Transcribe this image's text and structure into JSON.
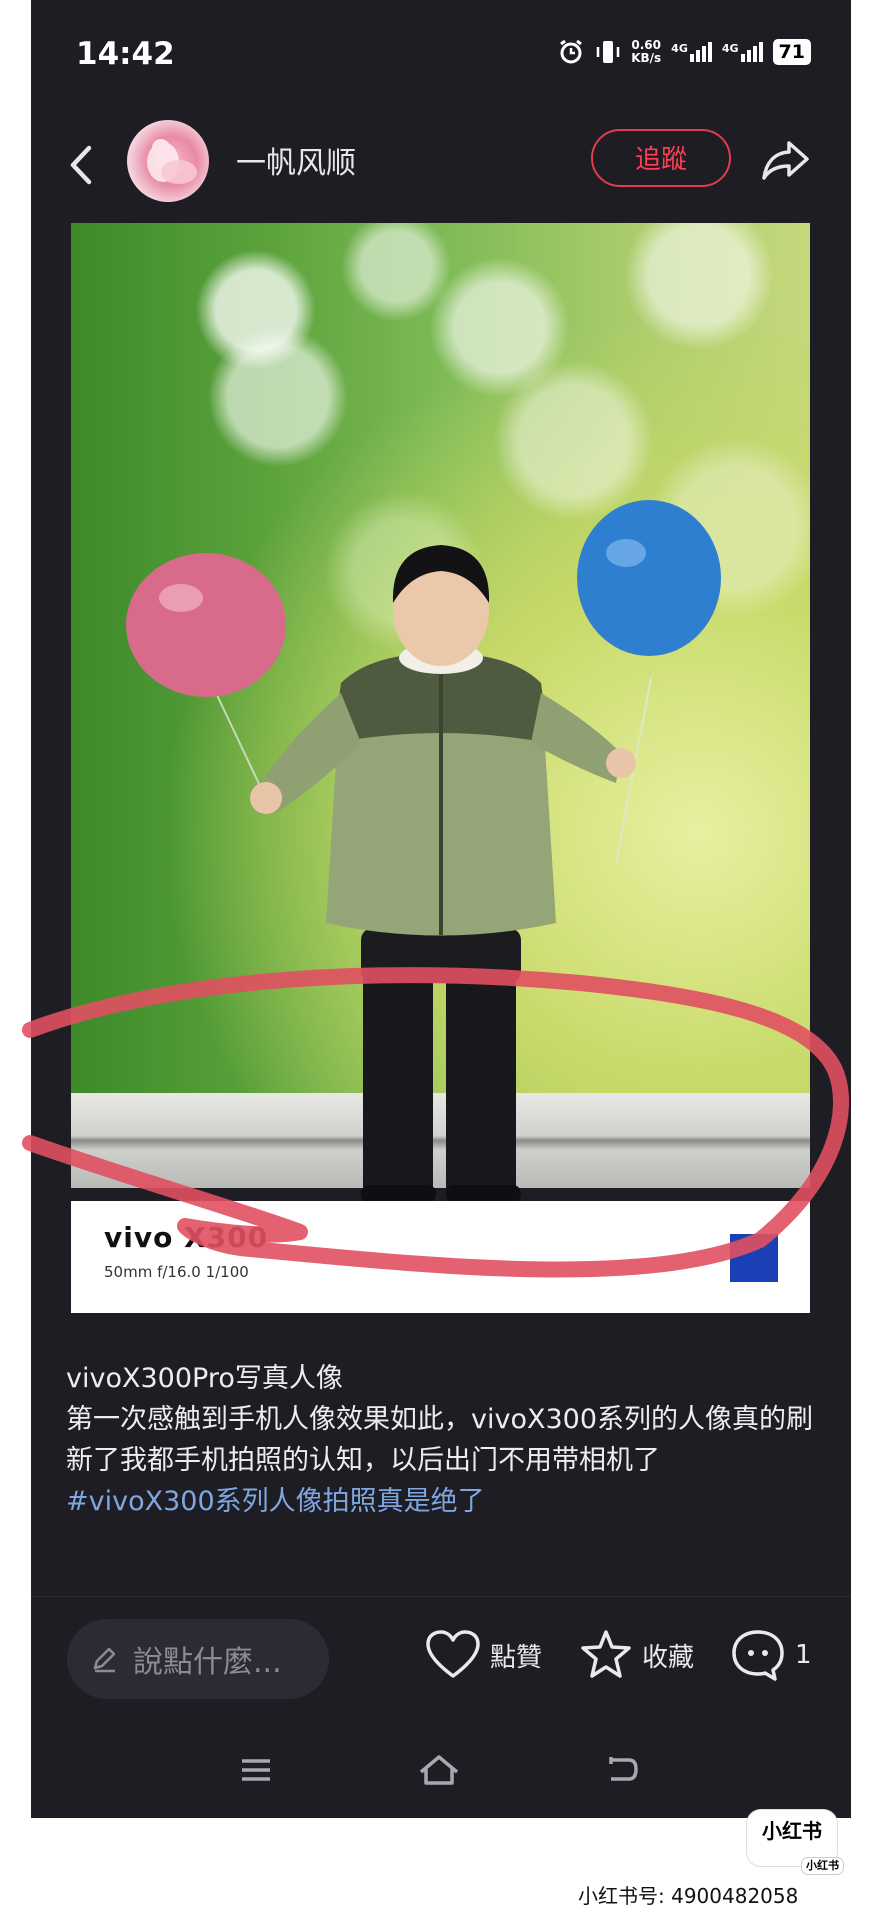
{
  "status_bar": {
    "time": "14:42",
    "net_speed_value": "0.60",
    "net_speed_unit": "KB/s",
    "network_1": "4G",
    "network_2": "4G",
    "battery": "71"
  },
  "header": {
    "username": "一帆风顺",
    "follow_label": "追蹤",
    "icons": [
      "back-arrow",
      "avatar",
      "share-arrow"
    ]
  },
  "photo": {
    "watermark_brand": "vivo X300",
    "watermark_spec": "50mm  f/16.0  1/100",
    "colors": {
      "bokeh": "#7dba55",
      "balloon_pink": "#d96b8a",
      "balloon_blue": "#2f7fd0",
      "scribble": "#e05060"
    }
  },
  "caption": {
    "title": "vivoX300Pro写真人像",
    "body": "第一次感触到手机人像效果如此，vivoX300系列的人像真的刷新了我都手机拍照的认知，以后出门不用带相机了",
    "hashtag": "#vivoX300系列人像拍照真是绝了"
  },
  "actions": {
    "comment_placeholder": "說點什麼...",
    "like_label": "點贊",
    "favorite_label": "收藏",
    "comment_count": "1"
  },
  "footer": {
    "logo_text": "小红书",
    "logo_small": "小红书",
    "id_text": "小红书号: 4900482058"
  }
}
